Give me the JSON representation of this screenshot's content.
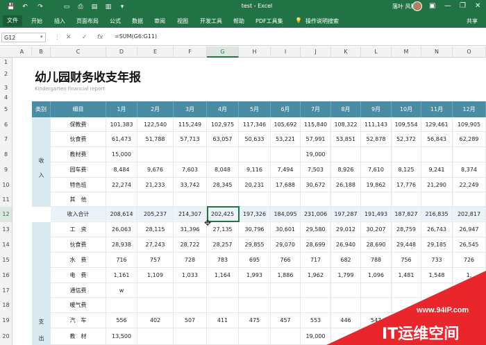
{
  "titlebar": {
    "save": "💾",
    "undo": "↶",
    "redo": "↷",
    "doc_title": "test  -  Excel",
    "user": "落叶 风秋",
    "minimize": "—",
    "restore": "❐",
    "close": "✕"
  },
  "ribbon": {
    "file": "文件",
    "tabs": [
      "开始",
      "插入",
      "页面布局",
      "公式",
      "数据",
      "审阅",
      "视图",
      "开发工具",
      "帮助",
      "PDF工具集"
    ],
    "tell_me": "操作说明搜索",
    "share": "共享"
  },
  "formula": {
    "name_box": "G12",
    "cancel": "✕",
    "enter": "✓",
    "fx": "fx",
    "value": "=SUM(G6:G11)"
  },
  "columns": [
    "A",
    "B",
    "C",
    "D",
    "E",
    "F",
    "G",
    "H",
    "I",
    "J",
    "K",
    "L",
    "M",
    "N",
    "O"
  ],
  "rows": [
    "1",
    "2",
    "3",
    "4",
    "5",
    "6",
    "7",
    "8",
    "9",
    "10",
    "11",
    "12",
    "13",
    "14",
    "15",
    "16",
    "17",
    "18",
    "19",
    "20"
  ],
  "report": {
    "title": "幼儿园财务收支年报",
    "subtitle": "Kindergarten financial report"
  },
  "table_header": [
    "类别",
    "细目",
    "1月",
    "2月",
    "3月",
    "4月",
    "5月",
    "6月",
    "7月",
    "8月",
    "9月",
    "10月",
    "11月",
    "12月"
  ],
  "income_label": [
    "收",
    "入"
  ],
  "expense_label": [
    "支",
    "出"
  ],
  "table_rows": [
    {
      "item": "保教费",
      "vals": [
        "101,383",
        "122,540",
        "115,249",
        "102,975",
        "117,346",
        "105,692",
        "115,840",
        "108,322",
        "111,143",
        "109,554",
        "129,461",
        "109,905"
      ]
    },
    {
      "item": "伙食费",
      "vals": [
        "61,473",
        "51,788",
        "57,713",
        "63,057",
        "50,633",
        "53,221",
        "57,991",
        "53,851",
        "52,878",
        "52,372",
        "56,843",
        "62,289"
      ]
    },
    {
      "item": "教材费",
      "vals": [
        "15,000",
        "",
        "",
        "",
        "",
        "",
        "19,000",
        "",
        "",
        "",
        "",
        ""
      ]
    },
    {
      "item": "园车费",
      "vals": [
        "8,484",
        "9,676",
        "7,603",
        "8,048",
        "9,116",
        "7,494",
        "7,503",
        "8,926",
        "7,610",
        "8,125",
        "9,241",
        "8,374"
      ]
    },
    {
      "item": "特色班",
      "vals": [
        "22,274",
        "21,233",
        "33,742",
        "28,345",
        "20,231",
        "17,688",
        "30,672",
        "26,188",
        "19,862",
        "17,776",
        "21,290",
        "22,249"
      ]
    },
    {
      "item": "其　他",
      "vals": [
        "",
        "",
        "",
        "",
        "",
        "",
        "",
        "",
        "",
        "",
        "",
        ""
      ]
    },
    {
      "item": "收入合计",
      "vals": [
        "208,614",
        "205,237",
        "214,307",
        "202,425",
        "197,326",
        "184,095",
        "231,006",
        "197,287",
        "191,493",
        "187,827",
        "216,835",
        "202,817"
      ]
    },
    {
      "item": "工　资",
      "vals": [
        "26,063",
        "28,115",
        "31,396",
        "27,135",
        "30,796",
        "30,601",
        "29,580",
        "29,012",
        "30,207",
        "28,759",
        "26,743",
        "26,947"
      ]
    },
    {
      "item": "伙食费",
      "vals": [
        "28,938",
        "27,243",
        "28,722",
        "28,257",
        "29,855",
        "29,070",
        "28,699",
        "26,940",
        "28,690",
        "29,448",
        "29,185",
        "26,545"
      ]
    },
    {
      "item": "水　费",
      "vals": [
        "716",
        "757",
        "728",
        "783",
        "695",
        "766",
        "717",
        "682",
        "788",
        "756",
        "733",
        "726"
      ]
    },
    {
      "item": "电　费",
      "vals": [
        "1,161",
        "1,109",
        "1,033",
        "1,164",
        "1,993",
        "1,886",
        "1,962",
        "1,799",
        "1,096",
        "1,481",
        "1,548",
        "1,"
      ]
    },
    {
      "item": "通信费",
      "vals": [
        "w",
        "",
        "",
        "",
        "",
        "",
        "",
        "",
        "",
        "",
        "",
        ""
      ]
    },
    {
      "item": "暖气费",
      "vals": [
        "",
        "",
        "",
        "",
        "",
        "",
        "",
        "",
        "",
        "",
        "",
        ""
      ]
    },
    {
      "item": "汽　车",
      "vals": [
        "556",
        "402",
        "507",
        "411",
        "475",
        "457",
        "553",
        "446",
        "547",
        "",
        "",
        ""
      ]
    },
    {
      "item": "教　材",
      "vals": [
        "13,500",
        "",
        "",
        "",
        "",
        "",
        "19,000",
        "",
        "",
        "",
        "",
        ""
      ]
    }
  ],
  "watermark": {
    "url": "www.94IP.com",
    "brand": "IT运维空间"
  },
  "colors": {
    "excel_green": "#217346",
    "header_blue": "#4a8ca4",
    "category_bg": "#dbe9f0",
    "total_bg": "#eaf3f7",
    "watermark_red": "#e8262c"
  }
}
